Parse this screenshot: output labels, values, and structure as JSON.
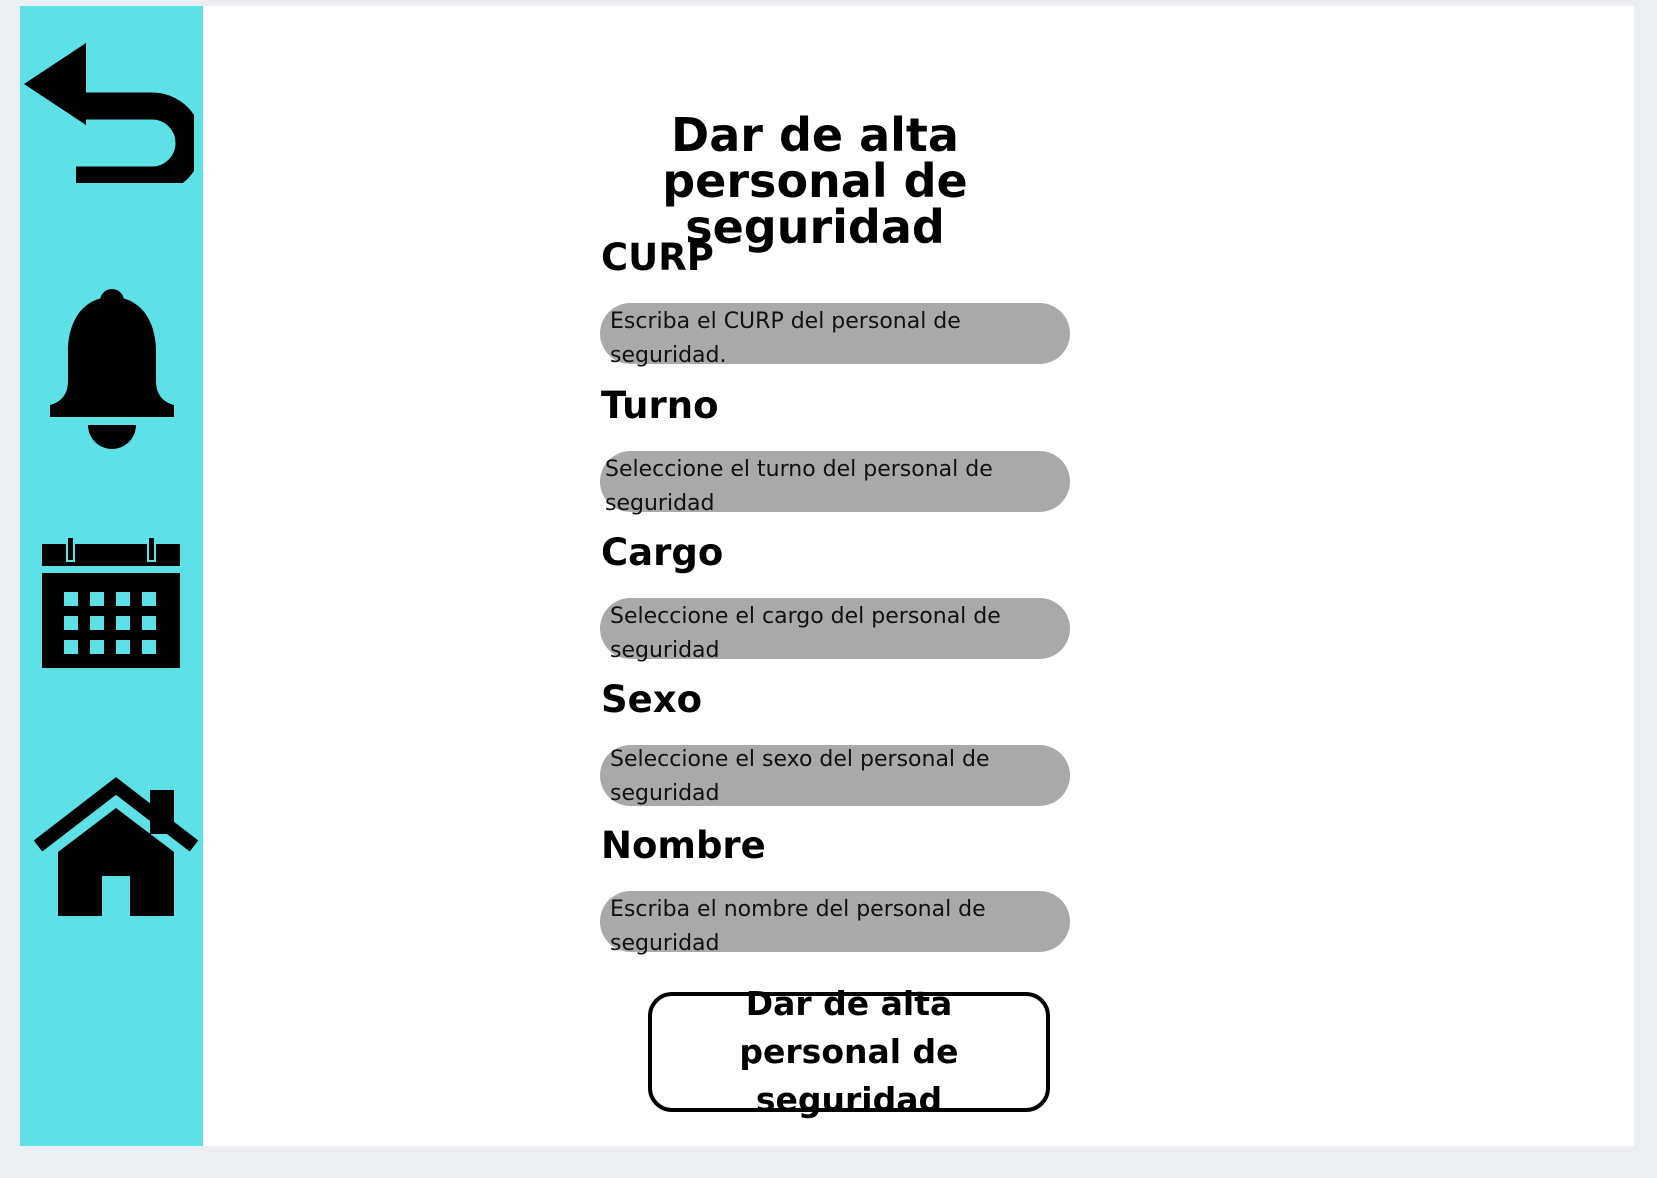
{
  "page": {
    "title": "Dar de alta personal de seguridad"
  },
  "sidebar": {
    "color": "#5de1e6",
    "items": [
      {
        "icon": "back-arrow-icon"
      },
      {
        "icon": "bell-icon"
      },
      {
        "icon": "calendar-icon"
      },
      {
        "icon": "home-icon"
      }
    ]
  },
  "form": {
    "fields": [
      {
        "label": "CURP",
        "placeholder": "Escriba el CURP del personal de seguridad."
      },
      {
        "label": "Turno",
        "placeholder": "Seleccione el turno del personal de seguridad"
      },
      {
        "label": "Cargo",
        "placeholder": "Seleccione el cargo del personal de seguridad"
      },
      {
        "label": "Sexo",
        "placeholder": "Seleccione el sexo del personal de seguridad"
      },
      {
        "label": "Nombre",
        "placeholder": "Escriba el nombre del personal de seguridad"
      }
    ],
    "submit_label": "Dar de alta personal de seguridad"
  }
}
